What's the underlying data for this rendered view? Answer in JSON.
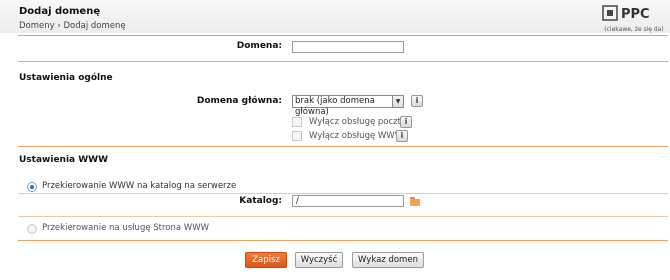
{
  "header": {
    "title": "Dodaj domenę",
    "breadcrumb": [
      "Domeny",
      "Dodaj domenę"
    ],
    "breadcrumb_sep": " › "
  },
  "watermark": {
    "tagline": "(ciekawe, że się da)"
  },
  "form": {
    "domain_label": "Domena:",
    "domain_value": "",
    "general_section": "Ustawienia ogólne",
    "main_domain_label": "Domena główna:",
    "main_domain_selected": "brak (jako domena główna)",
    "disable_mail_label": "Wyłącz obsługę poczty",
    "disable_mail_checked": false,
    "disable_www_label": "Wyłącz obsługę WWW",
    "disable_www_checked": false,
    "www_section": "Ustawienia WWW",
    "redirect_dir_label": "Przekierowanie WWW na katalog na serwerze",
    "redirect_dir_selected": true,
    "directory_label": "Katalog:",
    "directory_value": "/",
    "redirect_service_label": "Przekierowanie na usługę Strona WWW",
    "redirect_service_selected": false,
    "info_glyph": "i"
  },
  "buttons": {
    "save": "Zapisz",
    "clear": "Wyczyść",
    "list": "Wykaz domen"
  },
  "colors": {
    "accent": "#f47a3a",
    "divider": "#f0a060",
    "radio": "#1a73c8"
  }
}
